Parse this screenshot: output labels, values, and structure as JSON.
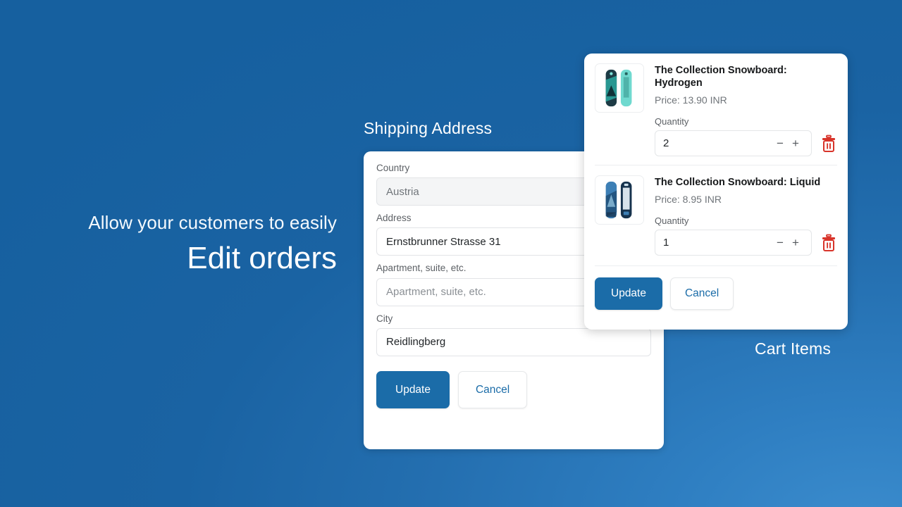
{
  "marketing": {
    "line1": "Allow your customers to easily",
    "line2": "Edit orders"
  },
  "captions": {
    "shipping": "Shipping Address",
    "cart": "Cart Items"
  },
  "shipping_form": {
    "fields": [
      {
        "label": "Country",
        "value": "Austria",
        "placeholder": "",
        "disabled": true
      },
      {
        "label": "Address",
        "value": "Ernstbrunner Strasse 31",
        "placeholder": "",
        "disabled": false
      },
      {
        "label": "Apartment, suite, etc.",
        "value": "",
        "placeholder": "Apartment, suite, etc.",
        "disabled": false
      },
      {
        "label": "City",
        "value": "Reidlingberg",
        "placeholder": "",
        "disabled": false
      }
    ],
    "update_label": "Update",
    "cancel_label": "Cancel"
  },
  "cart": {
    "items": [
      {
        "title": "The Collection Snowboard: Hydrogen",
        "price": "Price: 13.90 INR",
        "quantity_label": "Quantity",
        "quantity": "2",
        "decrement_label": "−",
        "increment_label": "+",
        "remove_icon": "trash-icon"
      },
      {
        "title": "The Collection Snowboard: Liquid",
        "price": "Price: 8.95 INR",
        "quantity_label": "Quantity",
        "quantity": "1",
        "decrement_label": "−",
        "increment_label": "+",
        "remove_icon": "trash-icon"
      }
    ],
    "update_label": "Update",
    "cancel_label": "Cancel"
  },
  "colors": {
    "background_blue": "#16609f",
    "background_blue_light": "#3b8ccd",
    "accent_blue": "#1b6ca8",
    "danger_red": "#d8342a",
    "card_white": "#ffffff",
    "muted_text": "#70757a"
  }
}
